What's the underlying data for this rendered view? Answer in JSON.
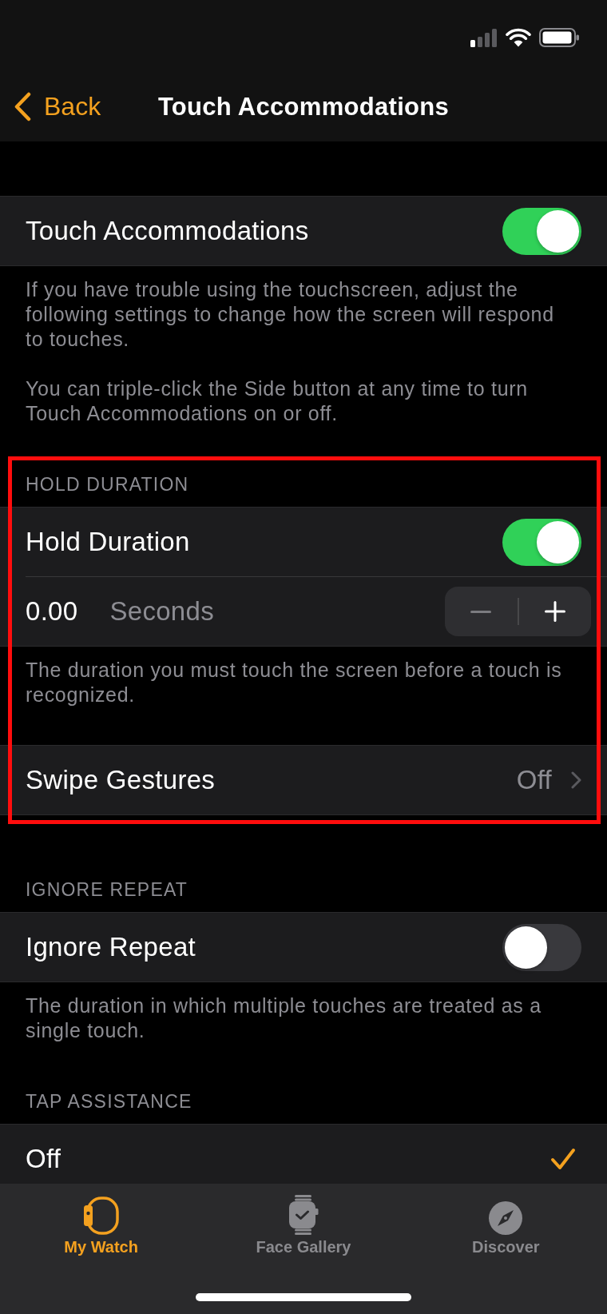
{
  "nav_bar": {
    "back": "Back",
    "title": "Touch Accommodations"
  },
  "groups": [
    {
      "highlighted": false,
      "sections": [
        {
          "rows": [
            {
              "kind": "toggle",
              "label": "Touch Accommodations",
              "on": true
            }
          ],
          "footer": [
            "If you have trouble using the touchscreen, adjust the following settings to change how the screen will respond to touches.",
            "You can triple-click the Side button at any time to turn Touch Accommodations on or off."
          ]
        }
      ]
    },
    {
      "highlighted": true,
      "sections": [
        {
          "header": "HOLD DURATION",
          "rows": [
            {
              "kind": "toggle",
              "label": "Hold Duration",
              "on": true
            },
            {
              "kind": "stepper",
              "value": "0.00",
              "unit": "Seconds",
              "minus_disabled": true
            }
          ],
          "footer": [
            "The duration you must touch the screen before a touch is recognized."
          ]
        },
        {
          "rows": [
            {
              "kind": "disclosure",
              "label": "Swipe Gestures",
              "value": "Off"
            }
          ]
        }
      ]
    },
    {
      "highlighted": false,
      "sections": [
        {
          "header": "IGNORE REPEAT",
          "rows": [
            {
              "kind": "toggle",
              "label": "Ignore Repeat",
              "on": false
            }
          ],
          "footer": [
            "The duration in which multiple touches are treated as a single touch."
          ]
        },
        {
          "header": "TAP ASSISTANCE",
          "rows": [
            {
              "kind": "option",
              "label": "Off",
              "selected": true
            }
          ]
        }
      ]
    }
  ],
  "tab_bar": {
    "tabs": [
      {
        "label": "My Watch",
        "selected": true
      },
      {
        "label": "Face Gallery",
        "selected": false
      },
      {
        "label": "Discover",
        "selected": false
      }
    ]
  }
}
